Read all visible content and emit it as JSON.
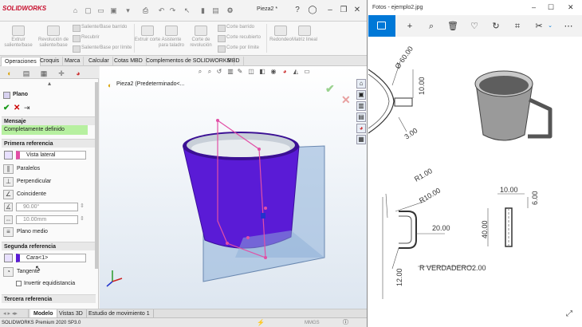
{
  "sw": {
    "logo": "SOLIDWORKS",
    "doc_title": "Pieza2 *",
    "ribbon": {
      "big": [
        {
          "label": "Extruir saliente/base"
        },
        {
          "label": "Revolución de saliente/base"
        },
        {
          "label": "Extruir corte"
        },
        {
          "label": "Asistente para taladro"
        },
        {
          "label": "Corte de revolución"
        },
        {
          "label": "Redondeo"
        },
        {
          "label": "Matriz lineal"
        }
      ],
      "small": [
        "Saliente/Base barrido",
        "Recubrir",
        "Saliente/Base por límite",
        "Corte barrido",
        "Corte recubierto",
        "Corte por límite"
      ]
    },
    "tabs": [
      "Operaciones",
      "Croquis",
      "Marca",
      "Calcular",
      "Cotas MBD",
      "Complementos de SOLIDWORKS",
      "MBD"
    ],
    "tree_item": "Pieza2 (Predeterminado<...",
    "panel": {
      "title": "Plano",
      "mensaje_header": "Mensaje",
      "message": "Completamente definido",
      "first_ref_header": "Primera referencia",
      "first_ref_value": "Vista lateral",
      "options": [
        "Paralelos",
        "Perpendicular",
        "Coincidente"
      ],
      "angle": "90.00°",
      "distance": "10.00mm",
      "plano_medio": "Plano medio",
      "second_ref_header": "Segunda referencia",
      "second_ref_value": "Cara<1>",
      "tangente": "Tangente",
      "invertir": "Invertir equidistancia",
      "third_ref_header": "Tercera referencia"
    },
    "bottom_tabs": [
      "Modelo",
      "Vistas 3D",
      "Estudio de movimiento 1"
    ],
    "status": "SOLIDWORKS Premium 2020 SP3.0",
    "units": "MMGS",
    "colors": {
      "accent": "#c8102e",
      "message_bg": "#b7f0a0",
      "cup": "#5a1bd6"
    }
  },
  "photos": {
    "title": "Fotos - ejemplo2.jpg",
    "dims": {
      "d1": "Ø 60.00",
      "d2": "10.00",
      "d3": "3.00",
      "d4": "R1.00",
      "d5": "R10.00",
      "d6": "20.00",
      "d7": "10.00",
      "d8": "6.00",
      "d9": "40.00",
      "d10": "12.00",
      "d11": "R VERDADERO2.00"
    },
    "colors": {
      "accent": "#0078d7"
    }
  }
}
